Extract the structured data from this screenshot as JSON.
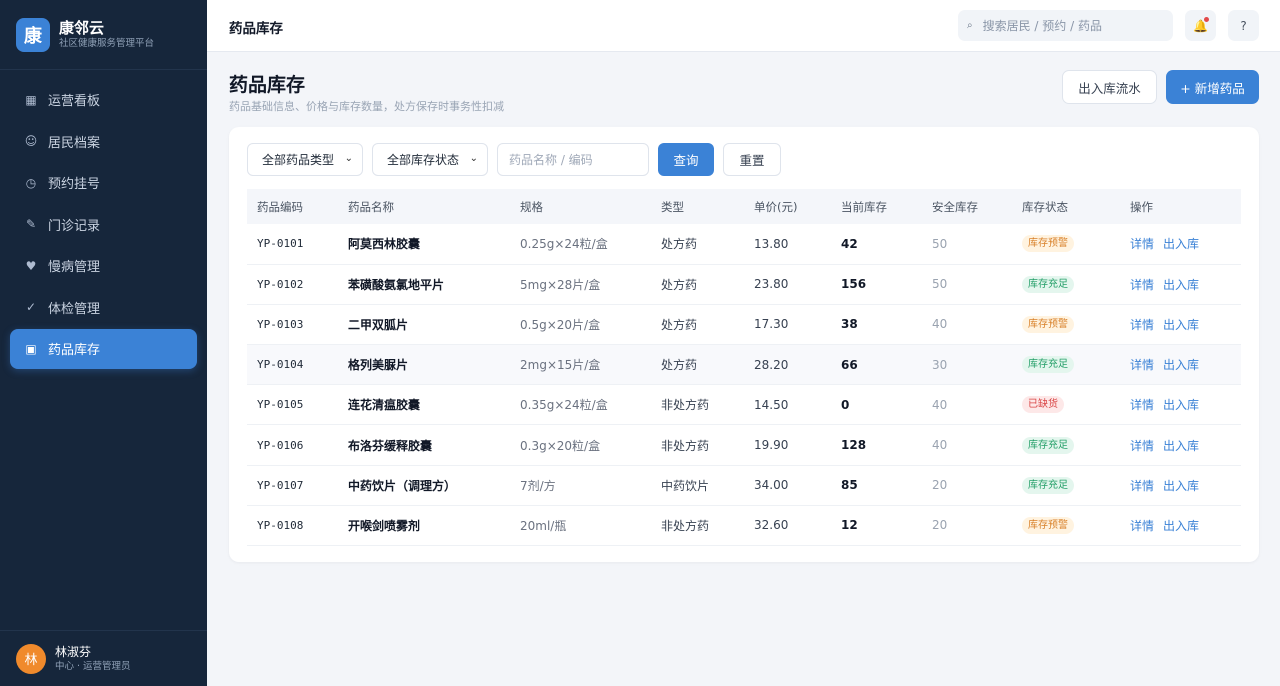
{
  "brand": {
    "logo": "康",
    "name": "康邻云",
    "subtitle": "社区健康服务管理平台"
  },
  "nav": [
    {
      "label": "运营看板",
      "icon": "grid-icon",
      "glyph": "▦"
    },
    {
      "label": "居民档案",
      "icon": "smile-icon",
      "glyph": "☺"
    },
    {
      "label": "预约挂号",
      "icon": "clock-icon",
      "glyph": "◷"
    },
    {
      "label": "门诊记录",
      "icon": "pen-icon",
      "glyph": "✎"
    },
    {
      "label": "慢病管理",
      "icon": "heart-icon",
      "glyph": "♥"
    },
    {
      "label": "体检管理",
      "icon": "check-icon",
      "glyph": "✓"
    },
    {
      "label": "药品库存",
      "icon": "box-icon",
      "glyph": "▣",
      "active": true
    }
  ],
  "user": {
    "avatar": "林",
    "name": "林淑芬",
    "role": "中心 · 运营管理员"
  },
  "topbar": {
    "title": "药品库存",
    "search_placeholder": "搜索居民 / 预约 / 药品",
    "help": "?"
  },
  "page": {
    "title": "药品库存",
    "subtitle": "药品基础信息、价格与库存数量，处方保存时事务性扣减",
    "flow_button": "出入库流水",
    "add_button": "+ 新增药品"
  },
  "filters": {
    "type_select": "全部药品类型",
    "status_select": "全部库存状态",
    "search_placeholder": "药品名称 / 编码",
    "query_button": "查询",
    "reset_button": "重置"
  },
  "table": {
    "columns": [
      "药品编码",
      "药品名称",
      "规格",
      "类型",
      "单价(元)",
      "当前库存",
      "安全库存",
      "库存状态",
      "操作"
    ],
    "actions": {
      "detail": "详情",
      "io": "出入库"
    },
    "rows": [
      {
        "code": "YP-0101",
        "name": "阿莫西林胶囊",
        "spec": "0.25g×24粒/盒",
        "type": "处方药",
        "price": "13.80",
        "stock": "42",
        "safe": "50",
        "status": "库存预警",
        "status_kind": "warn"
      },
      {
        "code": "YP-0102",
        "name": "苯磺酸氨氯地平片",
        "spec": "5mg×28片/盒",
        "type": "处方药",
        "price": "23.80",
        "stock": "156",
        "safe": "50",
        "status": "库存充足",
        "status_kind": "ok"
      },
      {
        "code": "YP-0103",
        "name": "二甲双胍片",
        "spec": "0.5g×20片/盒",
        "type": "处方药",
        "price": "17.30",
        "stock": "38",
        "safe": "40",
        "status": "库存预警",
        "status_kind": "warn"
      },
      {
        "code": "YP-0104",
        "name": "格列美脲片",
        "spec": "2mg×15片/盒",
        "type": "处方药",
        "price": "28.20",
        "stock": "66",
        "safe": "30",
        "status": "库存充足",
        "status_kind": "ok"
      },
      {
        "code": "YP-0105",
        "name": "连花清瘟胶囊",
        "spec": "0.35g×24粒/盒",
        "type": "非处方药",
        "price": "14.50",
        "stock": "0",
        "safe": "40",
        "status": "已缺货",
        "status_kind": "out"
      },
      {
        "code": "YP-0106",
        "name": "布洛芬缓释胶囊",
        "spec": "0.3g×20粒/盒",
        "type": "非处方药",
        "price": "19.90",
        "stock": "128",
        "safe": "40",
        "status": "库存充足",
        "status_kind": "ok"
      },
      {
        "code": "YP-0107",
        "name": "中药饮片（调理方）",
        "spec": "7剂/方",
        "type": "中药饮片",
        "price": "34.00",
        "stock": "85",
        "safe": "20",
        "status": "库存充足",
        "status_kind": "ok"
      },
      {
        "code": "YP-0108",
        "name": "开喉剑喷雾剂",
        "spec": "20ml/瓶",
        "type": "非处方药",
        "price": "32.60",
        "stock": "12",
        "safe": "20",
        "status": "库存预警",
        "status_kind": "warn"
      }
    ]
  }
}
